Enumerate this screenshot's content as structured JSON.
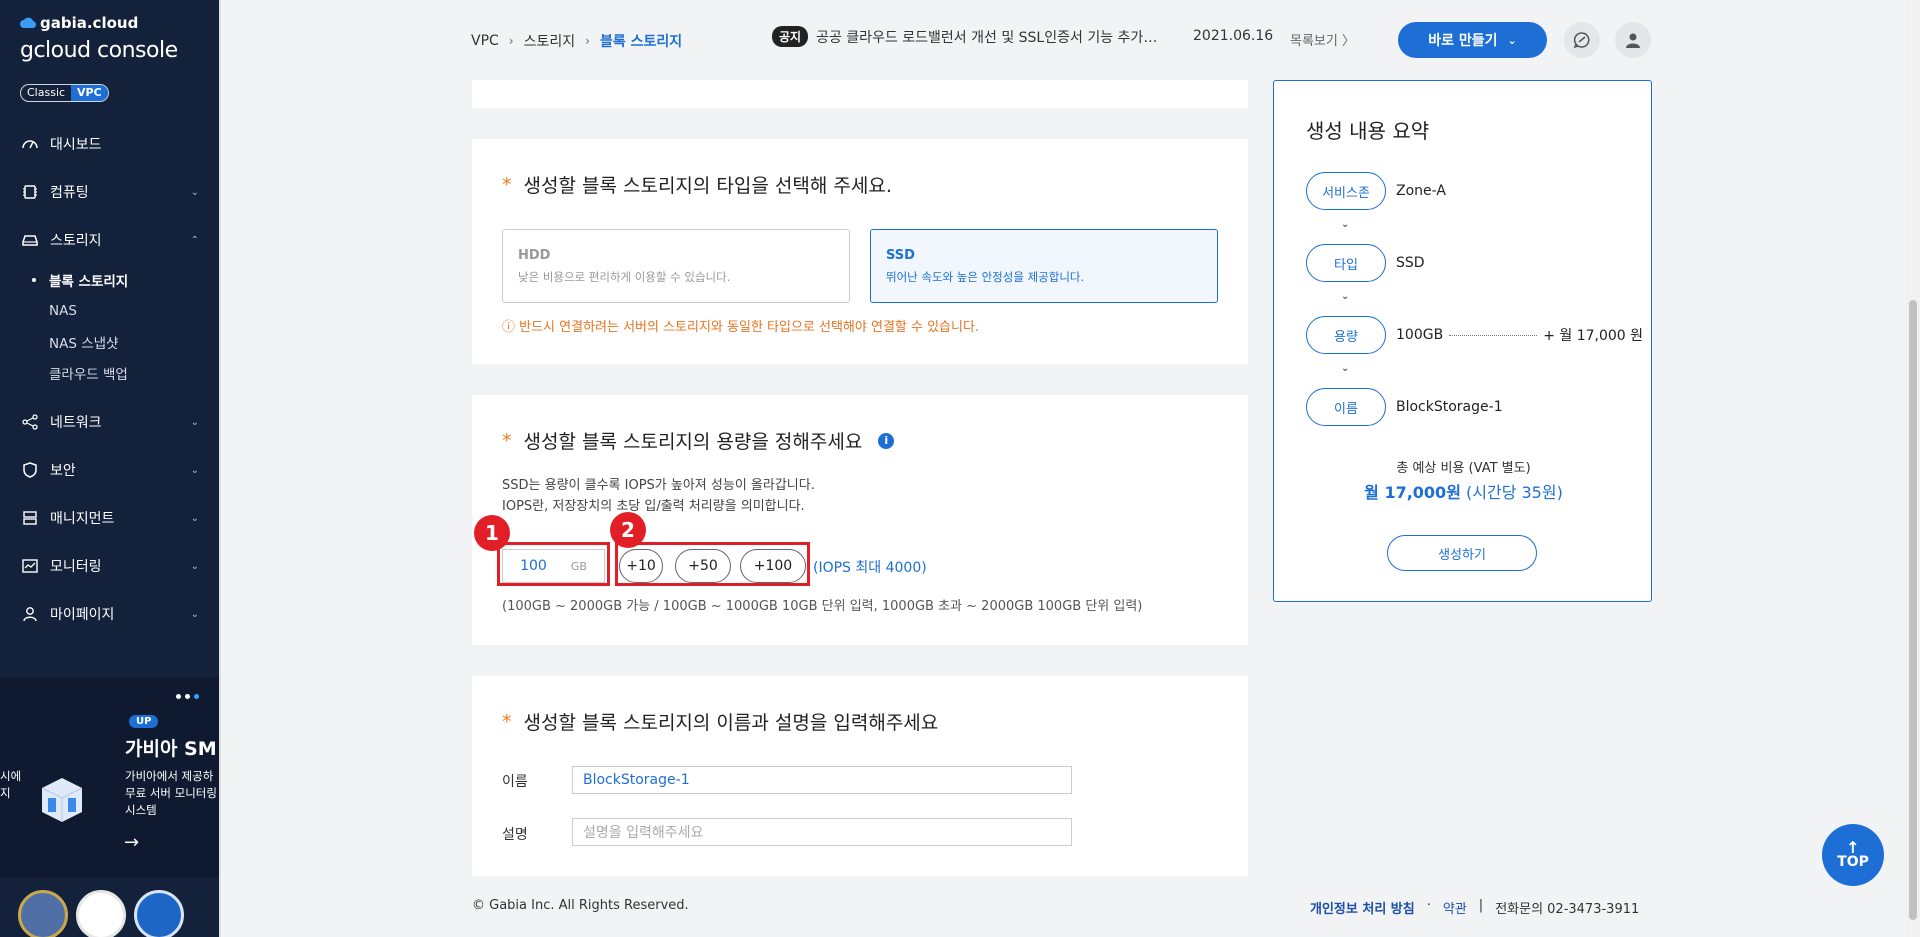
{
  "sidebar": {
    "logo_top": "gabia.cloud",
    "logo_main": "gcloud console",
    "mode_classic": "Classic",
    "mode_vpc": "VPC",
    "items": [
      {
        "label": "대시보드"
      },
      {
        "label": "컴퓨팅"
      },
      {
        "label": "스토리지"
      },
      {
        "label": "네트워크"
      },
      {
        "label": "보안"
      },
      {
        "label": "매니지먼트"
      },
      {
        "label": "모니터링"
      },
      {
        "label": "마이페이지"
      }
    ],
    "storage_sub": [
      "블록 스토리지",
      "NAS",
      "NAS 스냅샷",
      "클라우드 백업"
    ],
    "banner": {
      "badge": "UP",
      "title": "가비아 SM",
      "desc_line1": "가비아에서 제공하",
      "desc_line2": "무료 서버 모니터링",
      "desc_line3": "시스템",
      "left_line1": "시에",
      "left_line2": "지"
    }
  },
  "header": {
    "breadcrumb": [
      "VPC",
      "스토리지",
      "블록 스토리지"
    ],
    "notice_tag": "공지",
    "notice_text": "공공 클라우드 로드밸런서 개선 및 SSL인증서 기능 추가 안내",
    "notice_date": "2021.06.16",
    "more_label": "목록보기 〉",
    "create_label": "바로 만들기"
  },
  "type_section": {
    "title": "생성할 블록 스토리지의 타입을 선택해 주세요.",
    "options": [
      {
        "name": "HDD",
        "desc": "낮은 비용으로 편리하게 이용할 수 있습니다."
      },
      {
        "name": "SSD",
        "desc": "뛰어난 속도와 높은 안정성을 제공합니다."
      }
    ],
    "selected": "SSD",
    "warning": "ⓘ 반드시 연결하려는 서버의 스토리지와 동일한 타입으로 선택해야 연결할 수 있습니다."
  },
  "capacity_section": {
    "title": "생성할 블록 스토리지의 용량을 정해주세요",
    "desc_line1": "SSD는 용량이 클수록 IOPS가 높아져 성능이 올라갑니다.",
    "desc_line2": "IOPS란, 저장장치의 초당 입/출력 처리량을 의미합니다.",
    "value": "100",
    "unit": "GB",
    "steps": [
      "+10",
      "+50",
      "+100"
    ],
    "iops": "(IOPS 최대 4000)",
    "range": "(100GB ~ 2000GB 가능 / 100GB ~ 1000GB 10GB 단위 입력, 1000GB 초과 ~ 2000GB 100GB 단위 입력)",
    "badge1": "1",
    "badge2": "2"
  },
  "name_section": {
    "title": "생성할 블록 스토리지의 이름과 설명을 입력해주세요",
    "name_label": "이름",
    "name_value": "BlockStorage-1",
    "desc_label": "설명",
    "desc_placeholder": "설명을 입력해주세요"
  },
  "summary": {
    "title": "생성 내용 요약",
    "rows": [
      {
        "label": "서비스존",
        "value": "Zone-A"
      },
      {
        "label": "타입",
        "value": "SSD"
      },
      {
        "label": "용량",
        "value": "100GB",
        "price": "+ 월 17,000 원"
      },
      {
        "label": "이름",
        "value": "BlockStorage-1"
      }
    ],
    "total_label": "총 예상 비용 (VAT 별도)",
    "total_main": "월 17,000원",
    "total_sub": " (시간당 35원)",
    "button": "생성하기"
  },
  "footer": {
    "copyright": "© Gabia Inc. All Rights Reserved.",
    "privacy": "개인정보 처리 방침",
    "dot": "·",
    "terms": "약관",
    "bar": "|",
    "phone": "전화문의  02-3473-3911"
  },
  "top_button": "TOP"
}
